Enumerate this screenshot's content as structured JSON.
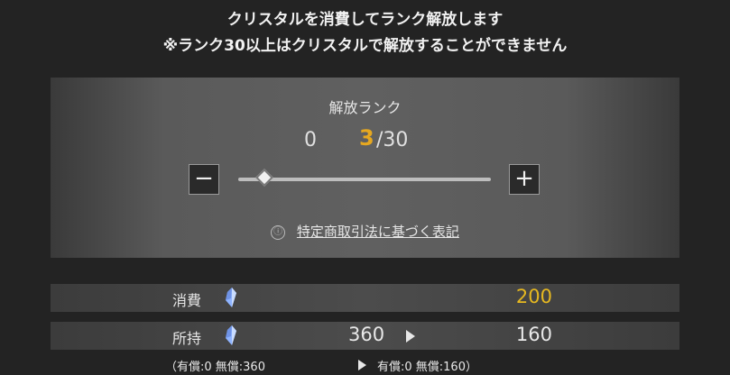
{
  "header": {
    "line1": "クリスタルを消費してランク解放します",
    "line2": "※ランク30以上はクリスタルで解放することができません"
  },
  "rank_panel": {
    "title": "解放ランク",
    "min": "0",
    "current": "3",
    "max": "/30",
    "minus_label": "−",
    "plus_label": "+",
    "slider": {
      "min": 0,
      "max": 30,
      "value": 3
    },
    "legal_icon": "ⓘ",
    "legal_link": "特定商取引法に基づく表記"
  },
  "cost_row": {
    "label": "消費",
    "value": "200"
  },
  "own_row": {
    "label": "所持",
    "before": "360",
    "after": "160"
  },
  "breakdown": {
    "before": "（有償:0 無償:360",
    "after": "有償:0 無償:160）"
  },
  "colors": {
    "accent": "#e6a820",
    "panel": "#5a5a5a",
    "crystal": "#8fb4ff"
  },
  "icons": {
    "crystal": "crystal-icon",
    "arrow": "arrow-right-icon",
    "info": "info-icon"
  }
}
